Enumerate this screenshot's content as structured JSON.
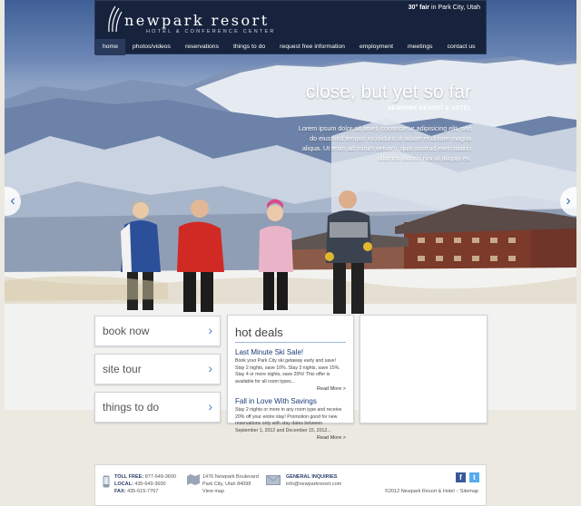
{
  "brand": {
    "name": "newpark resort",
    "tagline": "HOTEL & CONFERENCE CENTER"
  },
  "weather": {
    "temp": "30° fair",
    "location": "in Park City, Utah"
  },
  "nav": [
    "home",
    "photos/videos",
    "reservations",
    "things to do",
    "request free information",
    "employment",
    "meetings",
    "contact us"
  ],
  "hero": {
    "headline": "close, but yet so far",
    "subhead": "NEWPARK RESORT & HOTEL",
    "body": "Lorem ipsum dolor sit amet, consectetur adipisicing elit, sed do eiusmod tempor incididunt ut labore et dolore magna aliqua. Ut enim ad minim veniam, quis nostrud exercitation ullamco laboris nisi ut aliquip ex."
  },
  "actions": [
    "book now",
    "site tour",
    "things to do"
  ],
  "deals": {
    "title": "hot deals",
    "items": [
      {
        "title": "Last Minute Ski Sale!",
        "text": "Book your Park City ski getaway early and save! Stay 2 nights, save 10%. Stay 3 nights, save 15%. Stay 4 or more nights, save 20%! This offer is available for all room types...",
        "link": "Read More >"
      },
      {
        "title": "Fall in Love With Savings",
        "text": "Stay 2 nights or more in any room type and receive 20% off your entire stay! Promotion good for new reservations only with stay dates between September 1, 2012 and December 15, 2012...",
        "link": "Read More >"
      }
    ]
  },
  "footer": {
    "phones": [
      {
        "label": "TOLL FREE:",
        "value": "877-649-3600"
      },
      {
        "label": "LOCAL:",
        "value": "435-649-3600"
      },
      {
        "label": "FAX:",
        "value": "435-615-7767"
      }
    ],
    "address": [
      "1476 Newpark Boulevard",
      "Park City, Utah 84098",
      "View map"
    ],
    "inquiries_label": "GENERAL INQUIRIES",
    "email": "info@newparkresort.com",
    "copyright": "©2012 Newpark Resort & Hotel :: Sitemap"
  },
  "colors": {
    "header": "#17233d",
    "accent": "#4a7ec7",
    "deal_title": "#1d3b78"
  },
  "icons": [
    "phone-icon",
    "map-icon",
    "mail-icon",
    "facebook-icon",
    "twitter-icon",
    "arrow-left-icon",
    "arrow-right-icon",
    "chevron-right-icon"
  ]
}
